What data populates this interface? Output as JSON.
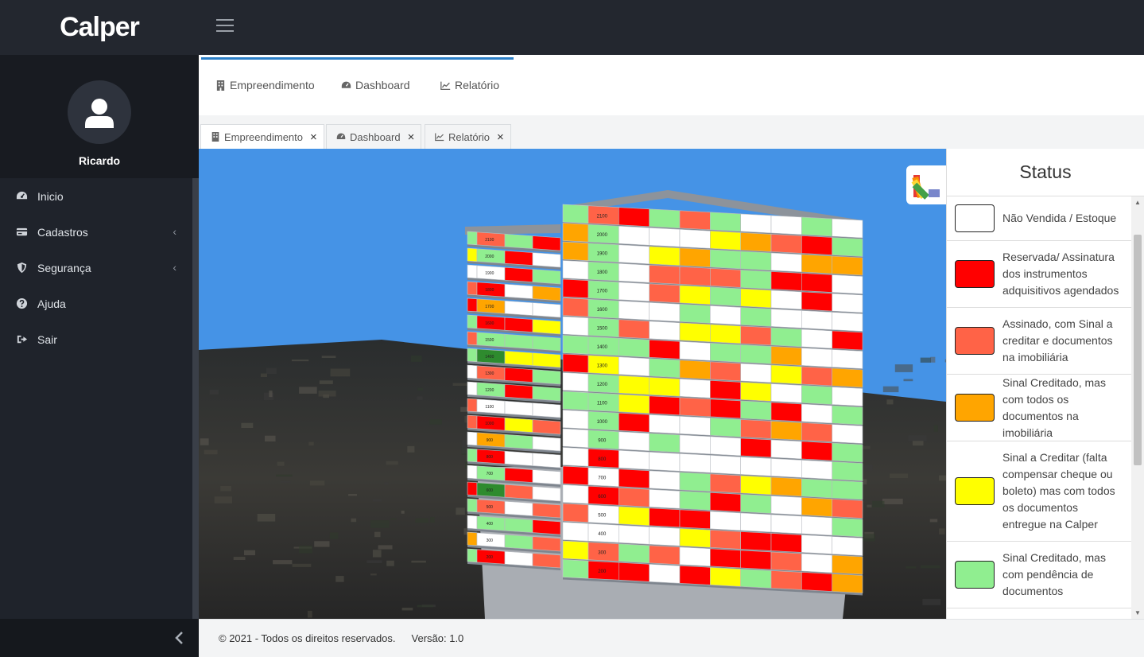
{
  "brand": {
    "name": "Calper"
  },
  "user": {
    "name": "Ricardo"
  },
  "sidebar": {
    "items": [
      {
        "label": "Inicio",
        "icon": "dashboard-icon"
      },
      {
        "label": "Cadastros",
        "icon": "card-icon",
        "chevron": "‹"
      },
      {
        "label": "Segurança",
        "icon": "shield-icon",
        "chevron": "‹"
      },
      {
        "label": "Ajuda",
        "icon": "question-icon"
      },
      {
        "label": "Sair",
        "icon": "sign-out-icon"
      }
    ]
  },
  "top_tabs": [
    {
      "label": "Empreendimento",
      "icon": "building-icon"
    },
    {
      "label": "Dashboard",
      "icon": "dashboard-icon"
    },
    {
      "label": "Relatório",
      "icon": "line-chart-icon"
    }
  ],
  "doc_tabs": [
    {
      "label": "Empreendimento",
      "icon": "building-icon",
      "close": "×",
      "active": true
    },
    {
      "label": "Dashboard",
      "icon": "dashboard-icon",
      "close": "×",
      "active": false
    },
    {
      "label": "Relatório",
      "icon": "line-chart-icon",
      "close": "×",
      "active": false
    }
  ],
  "status": {
    "title": "Status",
    "items": [
      {
        "label": "Não Vendida / Estoque",
        "color": "#ffffff"
      },
      {
        "label": "Reservada/ Assinatura dos instrumentos adquisitivos agendados",
        "color": "#ff0000"
      },
      {
        "label": "Assinado, com Sinal a creditar e documentos na imobiliária",
        "color": "#ff6347"
      },
      {
        "label": "Sinal Creditado, mas com todos os documentos na imobiliária",
        "color": "#ffa500"
      },
      {
        "label": "Sinal a Creditar (falta compensar cheque ou boleto) mas com todos os documentos entregue na Calper",
        "color": "#ffff00"
      },
      {
        "label": "Sinal Creditado, mas com pendência de documentos",
        "color": "#90ee90"
      }
    ]
  },
  "building": {
    "tower_a_floors": [
      "2100",
      "2000",
      "1900",
      "1800",
      "1700",
      "1600",
      "1500",
      "1400",
      "1300",
      "1200",
      "1100",
      "1000",
      "900",
      "800",
      "700",
      "600",
      "500",
      "400",
      "300",
      "200"
    ],
    "tower_b_floors": [
      "2100",
      "2000",
      "1900",
      "1800",
      "1700",
      "1600",
      "1500",
      "1400",
      "1300",
      "1200",
      "1100",
      "1000",
      "900",
      "800",
      "700",
      "600",
      "500",
      "400",
      "300",
      "200"
    ]
  },
  "footer": {
    "copyright": "© 2021 - Todos os direitos reservados.",
    "version": "Versão: 1.0"
  },
  "colors": {
    "accent": "#2b7fc8",
    "sky": "#4593e6",
    "topbar": "#23272f"
  }
}
